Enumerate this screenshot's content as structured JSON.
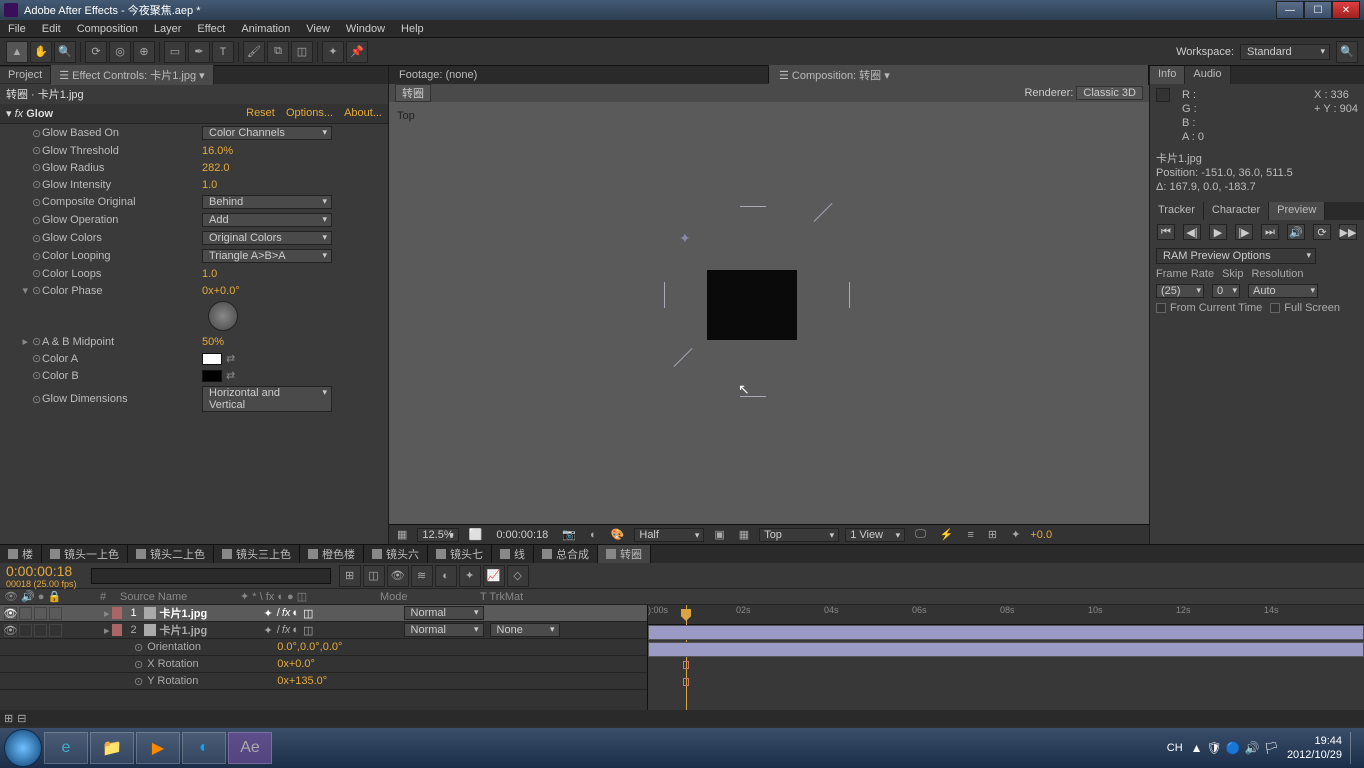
{
  "window": {
    "title": "Adobe After Effects - 今夜聚焦.aep *"
  },
  "menu": [
    "File",
    "Edit",
    "Composition",
    "Layer",
    "Effect",
    "Animation",
    "View",
    "Window",
    "Help"
  ],
  "workspace": {
    "label": "Workspace:",
    "value": "Standard"
  },
  "left": {
    "tabs": {
      "project": "Project",
      "effect": "Effect Controls: 卡片1.jpg"
    },
    "breadcrumb": "转圈 · 卡片1.jpg",
    "effect": {
      "name": "Glow",
      "reset": "Reset",
      "options": "Options...",
      "about": "About..."
    },
    "props": [
      {
        "label": "Glow Based On",
        "type": "dd",
        "value": "Color Channels"
      },
      {
        "label": "Glow Threshold",
        "type": "val",
        "value": "16.0%"
      },
      {
        "label": "Glow Radius",
        "type": "val",
        "value": "282.0"
      },
      {
        "label": "Glow Intensity",
        "type": "val",
        "value": "1.0"
      },
      {
        "label": "Composite Original",
        "type": "dd",
        "value": "Behind"
      },
      {
        "label": "Glow Operation",
        "type": "dd",
        "value": "Add"
      },
      {
        "label": "Glow Colors",
        "type": "dd",
        "value": "Original Colors"
      },
      {
        "label": "Color Looping",
        "type": "dd",
        "value": "Triangle A>B>A"
      },
      {
        "label": "Color Loops",
        "type": "val",
        "value": "1.0"
      },
      {
        "label": "Color Phase",
        "type": "val",
        "value": "0x+0.0°"
      },
      {
        "label": "A & B Midpoint",
        "type": "val",
        "value": "50%"
      },
      {
        "label": "Color A",
        "type": "color",
        "value": "#ffffff"
      },
      {
        "label": "Color B",
        "type": "color",
        "value": "#000000"
      },
      {
        "label": "Glow Dimensions",
        "type": "dd",
        "value": "Horizontal and Vertical"
      }
    ]
  },
  "center": {
    "tabs": {
      "footage": "Footage: (none)",
      "comp": "Composition: 转圈"
    },
    "comp_name": "转圈",
    "renderer_label": "Renderer:",
    "renderer": "Classic 3D",
    "vp_label": "Top",
    "footer": {
      "zoom": "12.5%",
      "time": "0:00:00:18",
      "res": "Half",
      "view": "Top",
      "views": "1 View",
      "exp": "+0.0"
    }
  },
  "info": {
    "tabs": [
      "Info",
      "Audio"
    ],
    "r": "R :",
    "g": "G :",
    "b": "B :",
    "a": "A :  0",
    "x": "X : 336",
    "y": "Y : 904",
    "layer": "卡片1.jpg",
    "pos": "Position: -151.0, 36.0, 511.5",
    "delta": "Δ: 167.9, 0.0, -183.7"
  },
  "preview": {
    "tabs": [
      "Tracker",
      "Character",
      "Preview"
    ],
    "ram": "RAM Preview Options",
    "framerate_l": "Frame Rate",
    "skip_l": "Skip",
    "res_l": "Resolution",
    "framerate": "(25)",
    "skip": "0",
    "res": "Auto",
    "fct": "From Current Time",
    "fs": "Full Screen"
  },
  "timeline": {
    "tabs": [
      "楼",
      "镜头一上色",
      "镜头二上色",
      "镜头三上色",
      "橙色楼",
      "镜头六",
      "镜头七",
      "线",
      "总合成",
      "转圈"
    ],
    "time": "0:00:00:18",
    "subtime": "00018 (25.00 fps)",
    "cols": {
      "source": "Source Name",
      "mode": "Mode",
      "trk": "T  TrkMat"
    },
    "layers": [
      {
        "num": "1",
        "name": "卡片1.jpg",
        "mode": "Normal",
        "trk": "",
        "sel": true
      },
      {
        "num": "2",
        "name": "卡片1.jpg",
        "mode": "Normal",
        "trk": "None",
        "sel": false
      }
    ],
    "props": [
      {
        "name": "Orientation",
        "value": "0.0°,0.0°,0.0°"
      },
      {
        "name": "X Rotation",
        "value": "0x+0.0°"
      },
      {
        "name": "Y Rotation",
        "value": "0x+135.0°"
      }
    ],
    "ticks": [
      "):00s",
      "02s",
      "04s",
      "06s",
      "08s",
      "10s",
      "12s",
      "14s"
    ]
  },
  "taskbar": {
    "lang": "CH",
    "time": "19:44",
    "date": "2012/10/29"
  }
}
